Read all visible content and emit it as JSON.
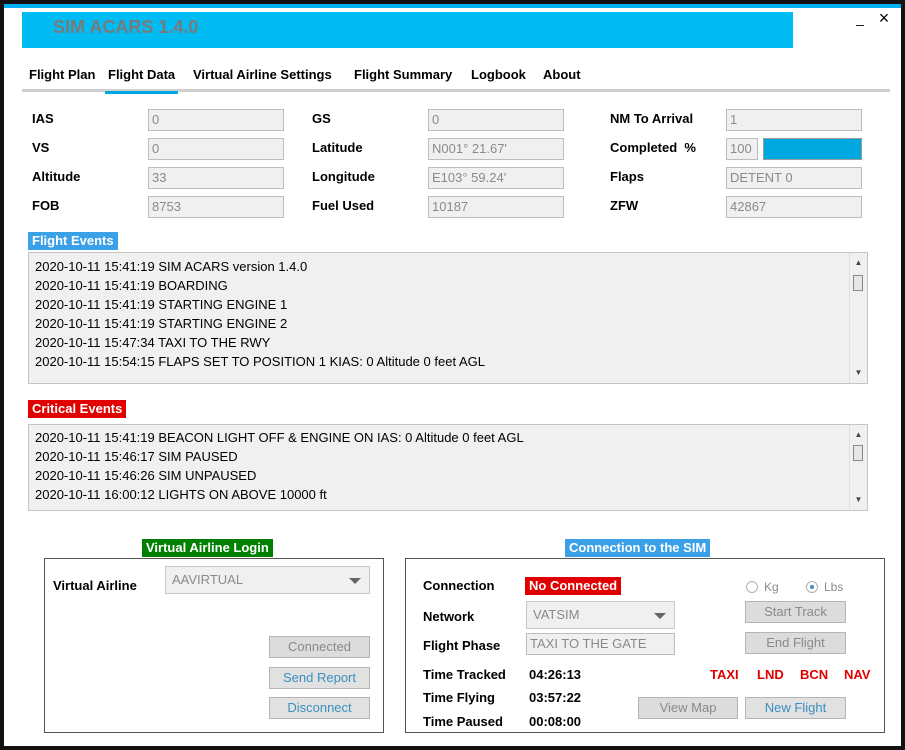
{
  "app": {
    "title": "SIM ACARS  1.4.0",
    "minimize": "_",
    "close": "×"
  },
  "tabs": [
    {
      "label": "Flight Plan"
    },
    {
      "label": "Flight Data"
    },
    {
      "label": "Virtual Airline Settings"
    },
    {
      "label": "Flight Summary"
    },
    {
      "label": "Logbook"
    },
    {
      "label": "About"
    }
  ],
  "active_tab": "Flight Data",
  "flight_data": {
    "ias": {
      "label": "IAS",
      "value": "0"
    },
    "vs": {
      "label": "VS",
      "value": "0"
    },
    "altitude": {
      "label": "Altitude",
      "value": "33"
    },
    "fob": {
      "label": "FOB",
      "value": "8753"
    },
    "gs": {
      "label": "GS",
      "value": "0"
    },
    "latitude": {
      "label": "Latitude",
      "value": "N001° 21.67'"
    },
    "longitude": {
      "label": "Longitude",
      "value": "E103° 59.24'"
    },
    "fuel_used": {
      "label": "Fuel Used",
      "value": "10187"
    },
    "nm_to_arrival": {
      "label": "NM To Arrival",
      "value": "1"
    },
    "completed": {
      "label": "Completed  %",
      "value": "100",
      "progress_percent": 100
    },
    "flaps": {
      "label": "Flaps",
      "value": "DETENT 0"
    },
    "zfw": {
      "label": "ZFW",
      "value": "42867"
    }
  },
  "flight_events": {
    "title": "Flight Events",
    "lines": [
      "2020-10-11 15:41:19 SIM ACARS version 1.4.0",
      "2020-10-11 15:41:19 BOARDING",
      "2020-10-11 15:41:19 STARTING ENGINE 1",
      "2020-10-11 15:41:19 STARTING ENGINE 2",
      "2020-10-11 15:47:34 TAXI TO THE RWY",
      "2020-10-11 15:54:15 FLAPS SET TO POSITION 1  KIAS: 0 Altitude 0 feet AGL"
    ]
  },
  "critical_events": {
    "title": "Critical Events",
    "lines": [
      "2020-10-11 15:41:19 BEACON LIGHT OFF & ENGINE ON  IAS: 0 Altitude 0 feet AGL",
      "2020-10-11 15:46:17 SIM PAUSED",
      "2020-10-11 15:46:26 SIM UNPAUSED",
      "2020-10-11 16:00:12 LIGHTS ON ABOVE 10000 ft"
    ]
  },
  "va_login": {
    "title": "Virtual Airline Login",
    "airline_label": "Virtual Airline",
    "airline_value": "AAVIRTUAL",
    "connected_button": "Connected",
    "send_report_button": "Send Report",
    "disconnect_button": "Disconnect"
  },
  "sim_connection": {
    "title": "Connection to the SIM",
    "connection_label": "Connection",
    "connection_status": "No Connected",
    "network_label": "Network",
    "network_value": "VATSIM",
    "phase_label": "Flight Phase",
    "phase_value": "TAXI TO THE GATE",
    "kg_label": "Kg",
    "lbs_label": "Lbs",
    "unit_selected": "Lbs",
    "start_track_button": "Start Track",
    "end_flight_button": "End Flight",
    "view_map_button": "View Map",
    "new_flight_button": "New Flight",
    "time_tracked_label": "Time Tracked",
    "time_tracked": "04:26:13",
    "time_flying_label": "Time Flying",
    "time_flying": "03:57:22",
    "time_paused_label": "Time Paused",
    "time_paused": "00:08:00",
    "lights": [
      "TAXI",
      "LND",
      "BCN",
      "NAV"
    ]
  },
  "colors": {
    "accent": "#00bcf2",
    "tab_underline": "#00a8e0",
    "critical": "#e00000",
    "va_green": "#008000",
    "events_blue": "#3aa0e8"
  }
}
